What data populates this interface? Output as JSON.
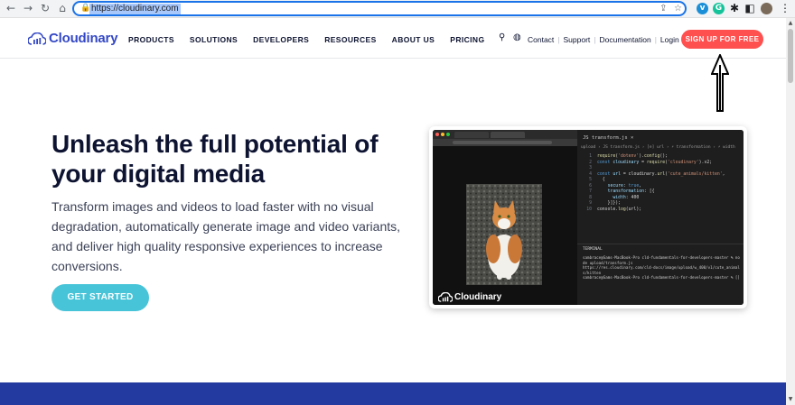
{
  "browser": {
    "url": "https://cloudinary.com",
    "back_icon": "←",
    "forward_icon": "→",
    "reload_icon": "↻",
    "home_icon": "⌂",
    "lock_icon": "🔒",
    "share_icon": "⇪",
    "star_icon": "☆",
    "ext_v": "v",
    "ext_g": "G",
    "puzzle_icon": "✱",
    "sidebar_icon": "◧",
    "menu_icon": "⋮",
    "scroll_up": "▲",
    "scroll_down": "▼"
  },
  "header": {
    "logo_text": "Cloudinary",
    "menu": [
      "PRODUCTS",
      "SOLUTIONS",
      "DEVELOPERS",
      "RESOURCES",
      "ABOUT US",
      "PRICING"
    ],
    "search_icon": "⚲",
    "globe_icon": "◍",
    "links": [
      "Contact",
      "Support",
      "Documentation",
      "Login"
    ],
    "signup_label": "SIGN UP FOR FREE"
  },
  "hero": {
    "title": "Unleash the full potential of your digital media",
    "description": "Transform images and videos to load faster with no visual degradation, automatically generate image and video variants, and deliver high quality responsive experiences to increase conversions.",
    "cta_label": "GET STARTED"
  },
  "demo": {
    "logo_text": "Cloudinary",
    "editor_tab": "JS transform.js ×",
    "breadcrumb": "upload › JS transform.js › [e] url › ⚡ transformation › ⚡ width",
    "terminal_label": "TERMINAL",
    "terminal_text": "sambrace@Sams-MacBook-Pro cld-fundamentals-for-developers-master % no\nde upload/transform.js\nhttps://res.cloudinary.com/cld-docs/image/upload/w_400/v1/cute_animal\ns/kitten\nsambrace@Sams-MacBook-Pro cld-fundamentals-for-developers-master % []"
  },
  "colors": {
    "brand": "#3448c5",
    "signup": "#ff5050",
    "cta": "#48c4d8",
    "footer": "#233ba0"
  }
}
